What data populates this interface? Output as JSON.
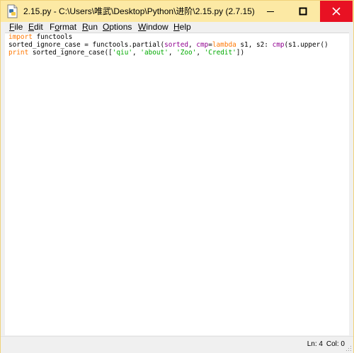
{
  "window": {
    "title": "2.15.py - C:\\Users\\唯武\\Desktop\\Python\\进阶\\2.15.py (2.7.15)",
    "icons": {
      "app": "python-file-icon",
      "minimize": "minimize-icon",
      "maximize": "maximize-icon",
      "close": "close-icon"
    },
    "colors": {
      "titlebar": "#fce9a4",
      "close_button": "#e81123"
    }
  },
  "menu": {
    "items": [
      {
        "label": "File",
        "mnemonic": "F"
      },
      {
        "label": "Edit",
        "mnemonic": "E"
      },
      {
        "label": "Format",
        "mnemonic": "o"
      },
      {
        "label": "Run",
        "mnemonic": "R"
      },
      {
        "label": "Options",
        "mnemonic": "O"
      },
      {
        "label": "Window",
        "mnemonic": "W"
      },
      {
        "label": "Help",
        "mnemonic": "H"
      }
    ]
  },
  "editor": {
    "lines": [
      [
        {
          "text": "import",
          "kind": "keyword"
        },
        {
          "text": " functools",
          "kind": "plain"
        }
      ],
      [
        {
          "text": "sorted_ignore_case = functools.partial(",
          "kind": "plain"
        },
        {
          "text": "sorted",
          "kind": "builtin"
        },
        {
          "text": ", ",
          "kind": "plain"
        },
        {
          "text": "cmp",
          "kind": "builtin"
        },
        {
          "text": "=",
          "kind": "plain"
        },
        {
          "text": "lambda",
          "kind": "keyword"
        },
        {
          "text": " s1, s2: ",
          "kind": "plain"
        },
        {
          "text": "cmp",
          "kind": "builtin"
        },
        {
          "text": "(s1.upper()",
          "kind": "plain"
        }
      ],
      [
        {
          "text": "print",
          "kind": "keyword"
        },
        {
          "text": " sorted_ignore_case([",
          "kind": "plain"
        },
        {
          "text": "'qiu'",
          "kind": "string"
        },
        {
          "text": ", ",
          "kind": "plain"
        },
        {
          "text": "'about'",
          "kind": "string"
        },
        {
          "text": ", ",
          "kind": "plain"
        },
        {
          "text": "'Zoo'",
          "kind": "string"
        },
        {
          "text": ", ",
          "kind": "plain"
        },
        {
          "text": "'Credit'",
          "kind": "string"
        },
        {
          "text": "])",
          "kind": "plain"
        }
      ]
    ],
    "colors": {
      "keyword": "#ff7700",
      "builtin": "#900090",
      "string": "#00aa00",
      "plain": "#000000"
    }
  },
  "status": {
    "line": "Ln: 4",
    "col": "Col: 0"
  }
}
